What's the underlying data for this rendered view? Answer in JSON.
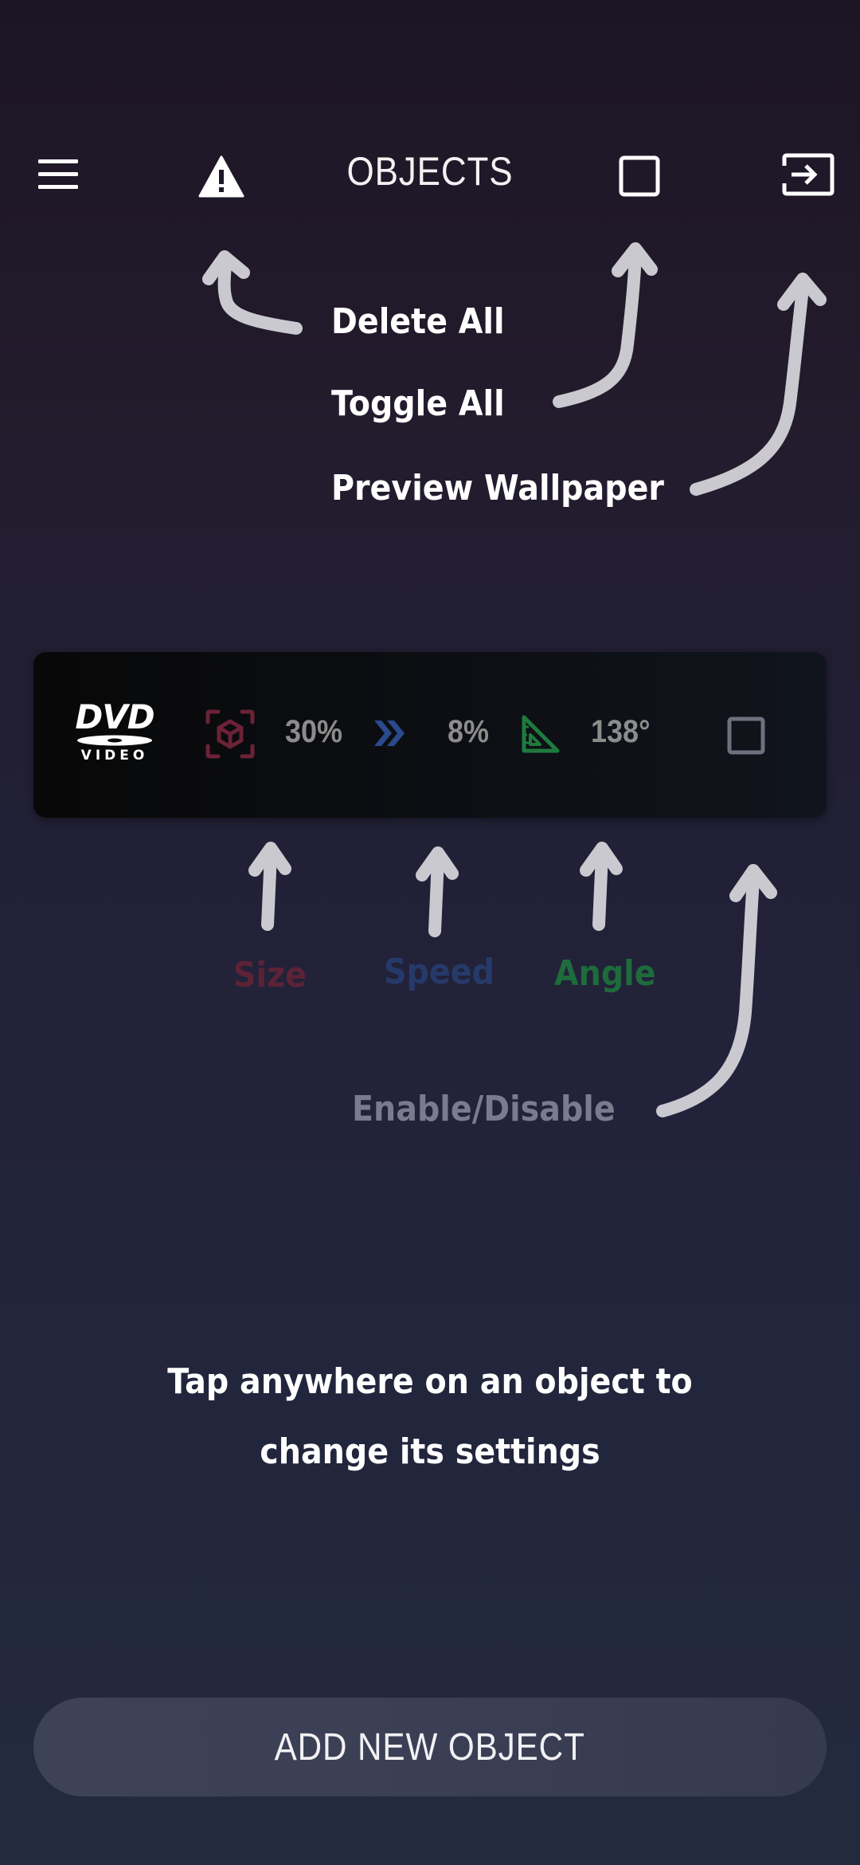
{
  "header": {
    "title": "OBJECTS",
    "menu_icon": "menu-icon",
    "delete_all_icon": "warning-icon",
    "toggle_all_icon": "checkbox-outline-icon",
    "preview_icon": "exit-to-app-icon"
  },
  "hints": {
    "delete_all": "Delete All",
    "toggle_all": "Toggle All",
    "preview_wallpaper": "Preview Wallpaper",
    "size": "Size",
    "speed": "Speed",
    "angle": "Angle",
    "enable_disable": "Enable/Disable"
  },
  "object_card": {
    "logo_word": "DVD",
    "logo_subword": "VIDEO",
    "size_icon": "cube-focus-icon",
    "size_value": "30%",
    "speed_icon": "double-chevron-right-icon",
    "speed_value": "8%",
    "angle_icon": "set-square-icon",
    "angle_value": "138°",
    "enabled": false,
    "colors": {
      "size": "#6b2236",
      "speed": "#2a4a8c",
      "angle": "#1f7a3e"
    }
  },
  "instruction": "Tap anywhere on an object  to\nchange its settings",
  "add_button": {
    "label": "ADD NEW OBJECT"
  }
}
